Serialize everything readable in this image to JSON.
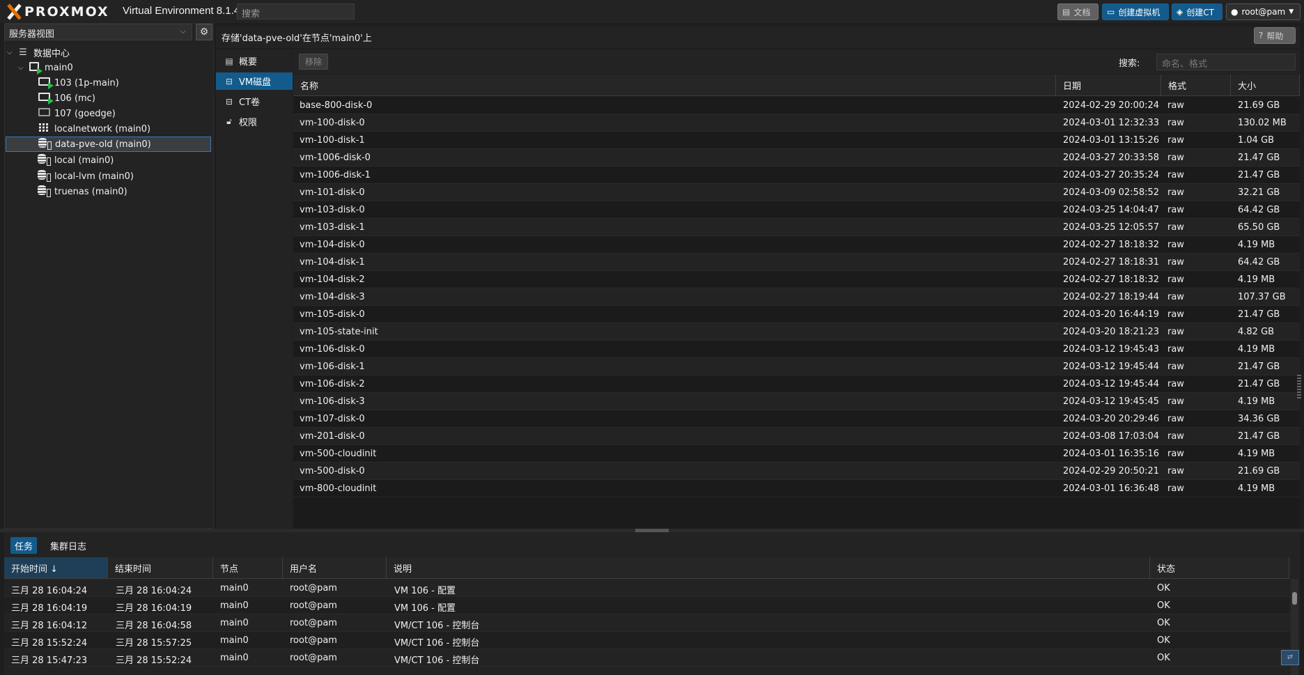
{
  "topbar": {
    "logo": "PROXMOX",
    "version": "Virtual Environment 8.1.4",
    "search_placeholder": "搜索",
    "docs_label": "文档",
    "create_vm_label": "创建虚拟机",
    "create_ct_label": "创建CT",
    "user_label": "root@pam"
  },
  "left": {
    "view_label": "服务器视图",
    "tree": [
      {
        "label": "数据中心"
      },
      {
        "label": "main0"
      },
      {
        "label": "103 (1p-main)"
      },
      {
        "label": "106 (mc)"
      },
      {
        "label": "107 (goedge)"
      },
      {
        "label": "localnetwork (main0)"
      },
      {
        "label": "data-pve-old (main0)"
      },
      {
        "label": "local (main0)"
      },
      {
        "label": "local-lvm (main0)"
      },
      {
        "label": "truenas (main0)"
      }
    ]
  },
  "content": {
    "title": "存储'data-pve-old'在节点'main0'上",
    "help_label": "帮助",
    "nav": [
      {
        "label": "概要"
      },
      {
        "label": "VM磁盘"
      },
      {
        "label": "CT卷"
      },
      {
        "label": "权限"
      }
    ],
    "remove_label": "移除",
    "search_label": "搜索:",
    "search_placeholder": "命名、格式",
    "columns": [
      "名称",
      "日期",
      "格式",
      "大小"
    ],
    "rows": [
      [
        "base-800-disk-0",
        "2024-02-29 20:00:24",
        "raw",
        "21.69 GB"
      ],
      [
        "vm-100-disk-0",
        "2024-03-01 12:32:33",
        "raw",
        "130.02 MB"
      ],
      [
        "vm-100-disk-1",
        "2024-03-01 13:15:26",
        "raw",
        "1.04 GB"
      ],
      [
        "vm-1006-disk-0",
        "2024-03-27 20:33:58",
        "raw",
        "21.47 GB"
      ],
      [
        "vm-1006-disk-1",
        "2024-03-27 20:35:24",
        "raw",
        "21.47 GB"
      ],
      [
        "vm-101-disk-0",
        "2024-03-09 02:58:52",
        "raw",
        "32.21 GB"
      ],
      [
        "vm-103-disk-0",
        "2024-03-25 14:04:47",
        "raw",
        "64.42 GB"
      ],
      [
        "vm-103-disk-1",
        "2024-03-25 12:05:57",
        "raw",
        "65.50 GB"
      ],
      [
        "vm-104-disk-0",
        "2024-02-27 18:18:32",
        "raw",
        "4.19 MB"
      ],
      [
        "vm-104-disk-1",
        "2024-02-27 18:18:31",
        "raw",
        "64.42 GB"
      ],
      [
        "vm-104-disk-2",
        "2024-02-27 18:18:32",
        "raw",
        "4.19 MB"
      ],
      [
        "vm-104-disk-3",
        "2024-02-27 18:19:44",
        "raw",
        "107.37 GB"
      ],
      [
        "vm-105-disk-0",
        "2024-03-20 16:44:19",
        "raw",
        "21.47 GB"
      ],
      [
        "vm-105-state-init",
        "2024-03-20 18:21:23",
        "raw",
        "4.82 GB"
      ],
      [
        "vm-106-disk-0",
        "2024-03-12 19:45:43",
        "raw",
        "4.19 MB"
      ],
      [
        "vm-106-disk-1",
        "2024-03-12 19:45:44",
        "raw",
        "21.47 GB"
      ],
      [
        "vm-106-disk-2",
        "2024-03-12 19:45:44",
        "raw",
        "21.47 GB"
      ],
      [
        "vm-106-disk-3",
        "2024-03-12 19:45:45",
        "raw",
        "4.19 MB"
      ],
      [
        "vm-107-disk-0",
        "2024-03-20 20:29:46",
        "raw",
        "34.36 GB"
      ],
      [
        "vm-201-disk-0",
        "2024-03-08 17:03:04",
        "raw",
        "21.47 GB"
      ],
      [
        "vm-500-cloudinit",
        "2024-03-01 16:35:16",
        "raw",
        "4.19 MB"
      ],
      [
        "vm-500-disk-0",
        "2024-02-29 20:50:21",
        "raw",
        "21.69 GB"
      ],
      [
        "vm-800-cloudinit",
        "2024-03-01 16:36:48",
        "raw",
        "4.19 MB"
      ]
    ]
  },
  "bottom": {
    "tabs": [
      "任务",
      "集群日志"
    ],
    "columns": [
      "开始时间 ↓",
      "结束时间",
      "节点",
      "用户名",
      "说明",
      "状态"
    ],
    "rows": [
      [
        "三月 28 16:04:24",
        "三月 28 16:04:24",
        "main0",
        "root@pam",
        "VM 106 - 配置",
        "OK"
      ],
      [
        "三月 28 16:04:19",
        "三月 28 16:04:19",
        "main0",
        "root@pam",
        "VM 106 - 配置",
        "OK"
      ],
      [
        "三月 28 16:04:12",
        "三月 28 16:04:58",
        "main0",
        "root@pam",
        "VM/CT 106 - 控制台",
        "OK"
      ],
      [
        "三月 28 15:52:24",
        "三月 28 15:57:25",
        "main0",
        "root@pam",
        "VM/CT 106 - 控制台",
        "OK"
      ],
      [
        "三月 28 15:47:23",
        "三月 28 15:52:24",
        "main0",
        "root@pam",
        "VM/CT 106 - 控制台",
        "OK"
      ]
    ]
  },
  "icons": {
    "accent": "#135b8c",
    "running": "#21bf4b",
    "logo_x": "#e57000"
  }
}
